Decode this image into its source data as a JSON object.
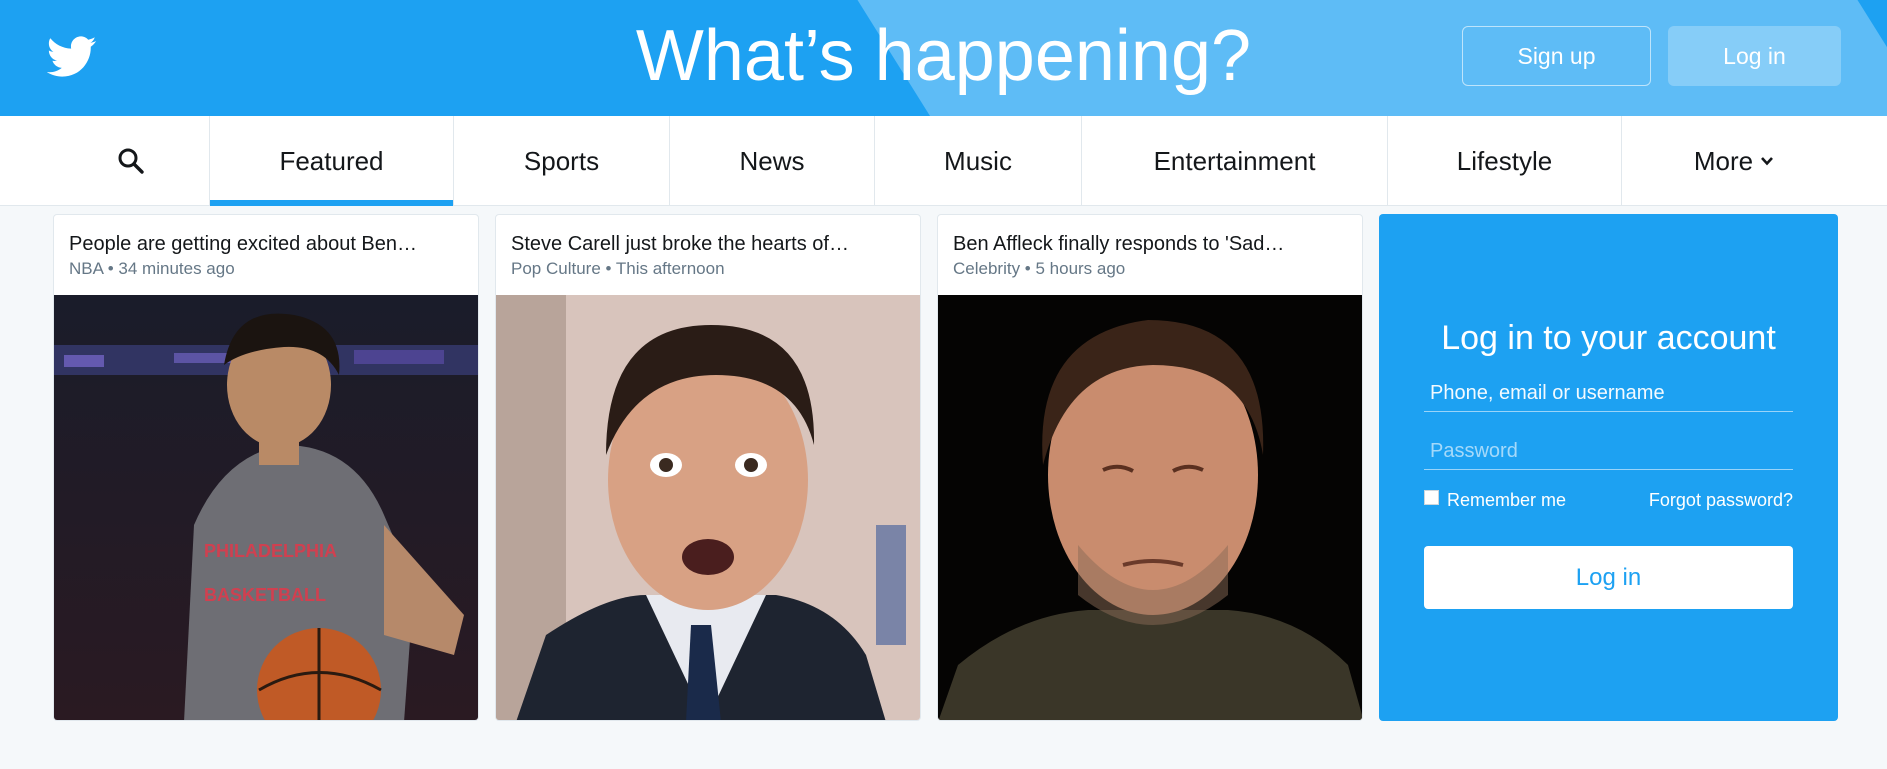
{
  "hero": {
    "title": "What’s happening?",
    "signup_label": "Sign up",
    "login_label": "Log in"
  },
  "nav": {
    "items": [
      {
        "label": "Featured",
        "active": true
      },
      {
        "label": "Sports"
      },
      {
        "label": "News"
      },
      {
        "label": "Music"
      },
      {
        "label": "Entertainment"
      },
      {
        "label": "Lifestyle"
      },
      {
        "label": "More"
      }
    ]
  },
  "cards": [
    {
      "title": "People are getting excited about Ben…",
      "meta": "NBA • 34 minutes ago"
    },
    {
      "title": "Steve Carell just broke the hearts of…",
      "meta": "Pop Culture • This afternoon"
    },
    {
      "title": "Ben Affleck finally responds to 'Sad…",
      "meta": "Celebrity • 5 hours ago"
    }
  ],
  "login": {
    "title": "Log in to your account",
    "username_placeholder": "Phone, email or username",
    "password_placeholder": "Password",
    "remember_label": "Remember me",
    "forgot_label": "Forgot password?",
    "button_label": "Log in"
  },
  "colors": {
    "brand": "#1da1f2",
    "brand_light": "#5ebcf6",
    "text": "#14171a",
    "muted": "#657786"
  },
  "icons": [
    "twitter-bird-icon",
    "search-icon",
    "chevron-down-icon"
  ]
}
